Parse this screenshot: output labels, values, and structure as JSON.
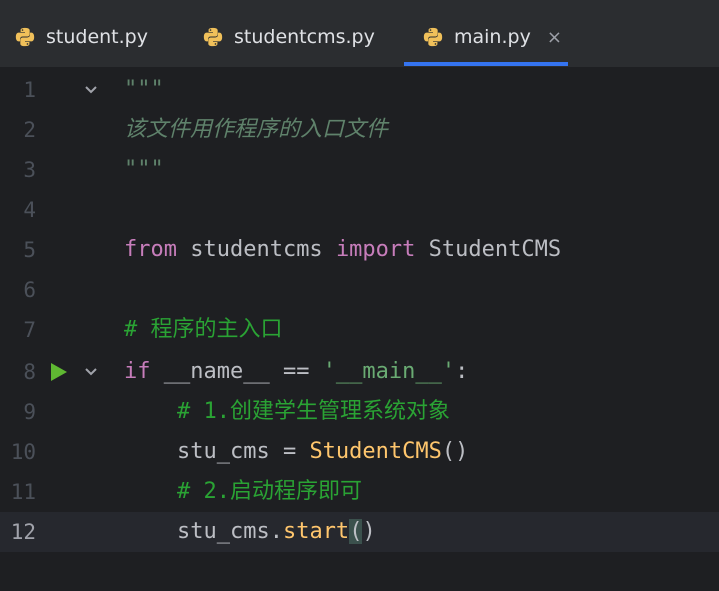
{
  "tabs": [
    {
      "label": "student.py",
      "icon": "python-file-icon",
      "active": false
    },
    {
      "label": "studentcms.py",
      "icon": "python-file-icon",
      "active": false
    },
    {
      "label": "main.py",
      "icon": "python-file-icon",
      "active": true,
      "close": "×"
    }
  ],
  "lines": [
    {
      "num": "1",
      "text": "\"\"\""
    },
    {
      "num": "2",
      "text": "该文件用作程序的入口文件"
    },
    {
      "num": "3",
      "text": "\"\"\""
    },
    {
      "num": "4",
      "text": ""
    },
    {
      "num": "5",
      "kw": "from",
      "mod": " studentcms ",
      "kw2": "import",
      "cls": " StudentCMS"
    },
    {
      "num": "6",
      "text": ""
    },
    {
      "num": "7",
      "text": "# 程序的主入口"
    },
    {
      "num": "8",
      "kw": "if",
      "mid": " __name__ == ",
      "str": "'__main__'",
      "end": ":"
    },
    {
      "num": "9",
      "text": "    # 1.创建学生管理系统对象"
    },
    {
      "num": "10",
      "pre": "    stu_cms = ",
      "fn": "StudentCMS",
      "end": "()"
    },
    {
      "num": "11",
      "text": "    # 2.启动程序即可"
    },
    {
      "num": "12",
      "pre": "    stu_cms.",
      "fn": "start",
      "p1": "(",
      "p2": ")"
    }
  ],
  "colors": {
    "accent": "#3574f0",
    "run": "#5fb832"
  }
}
